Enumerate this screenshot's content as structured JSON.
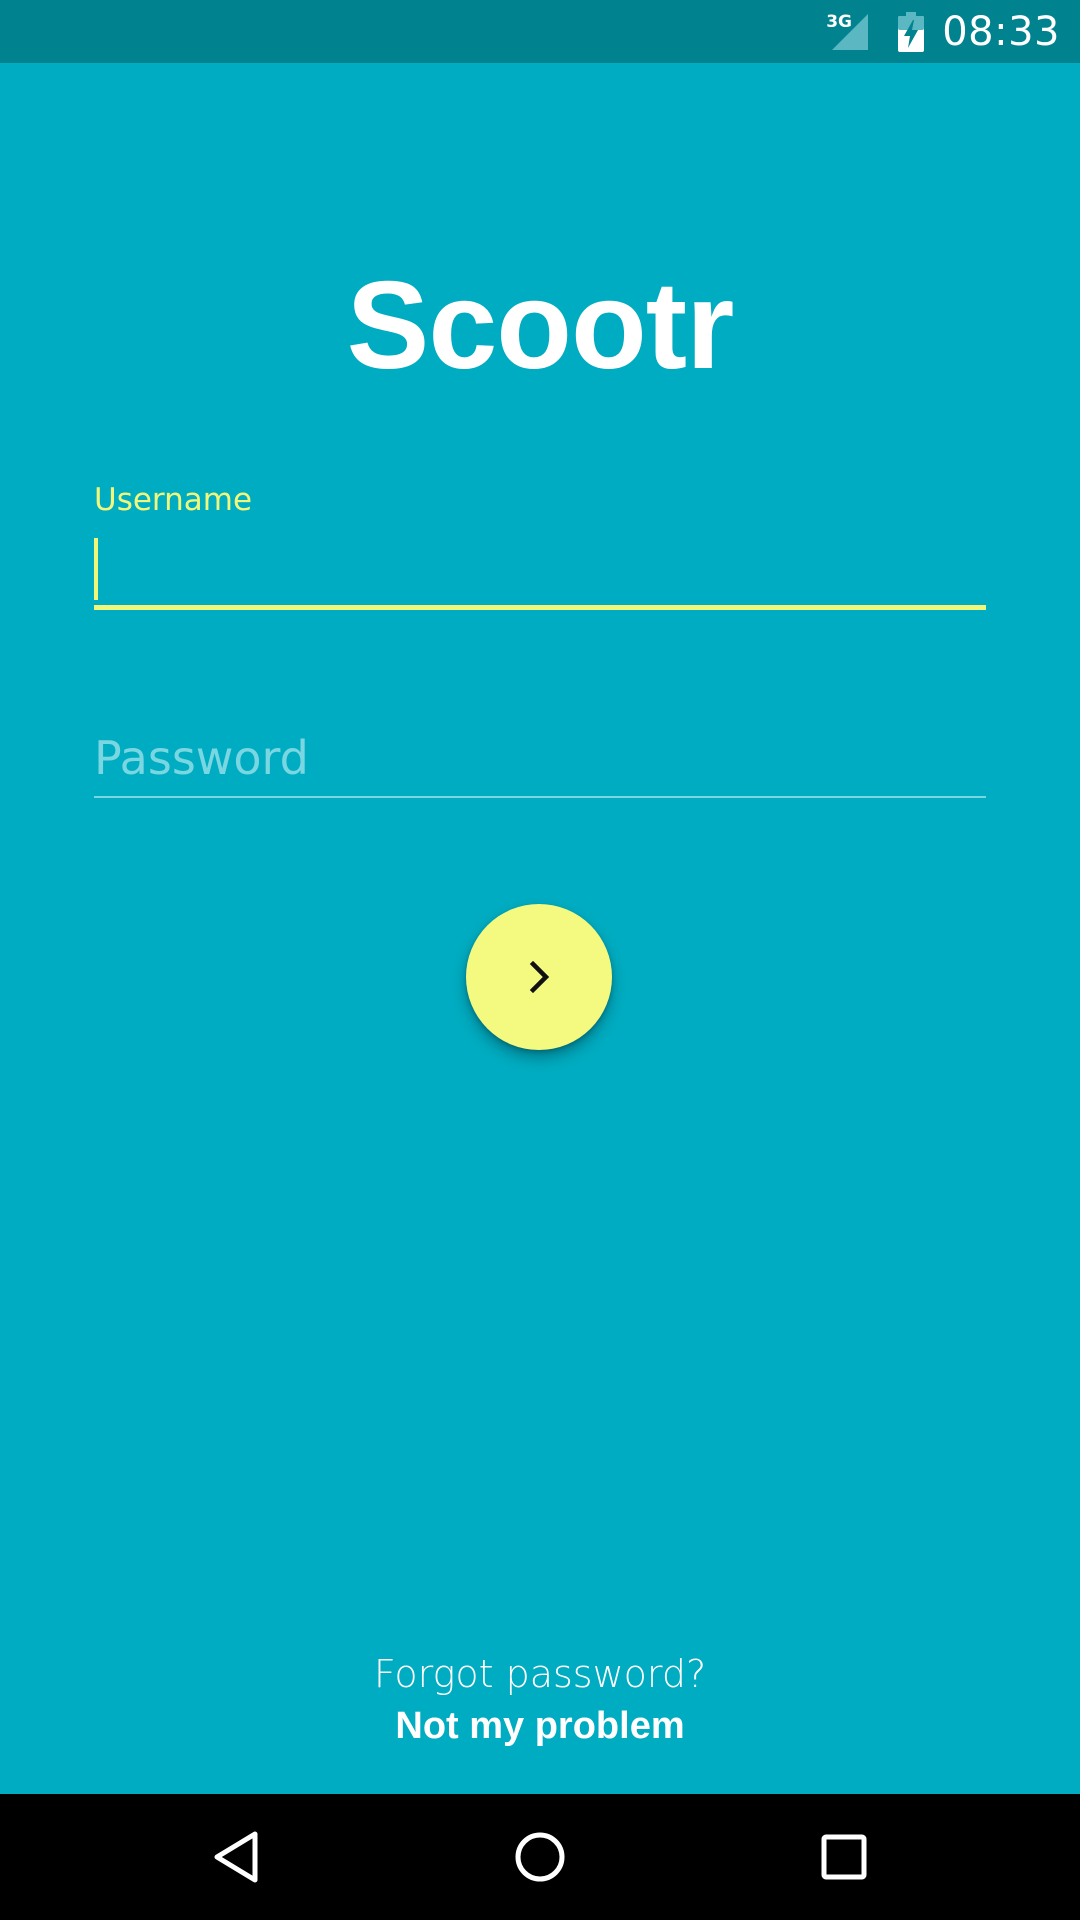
{
  "status_bar": {
    "network": "3G",
    "time": "08:33"
  },
  "app": {
    "title": "Scootr"
  },
  "form": {
    "username_label": "Username",
    "username_value": "",
    "password_placeholder": "Password",
    "password_value": ""
  },
  "submit_icon": "chevron-right-icon",
  "footer": {
    "forgot_text": "Forgot password?",
    "not_my_problem": "Not my problem"
  },
  "nav": {
    "back_icon": "back-triangle-icon",
    "home_icon": "home-circle-icon",
    "recents_icon": "recents-square-icon"
  },
  "colors": {
    "background": "#00ACC1",
    "status_bar": "#00838F",
    "accent": "#F4FA80",
    "label_active": "#F1F77A"
  }
}
